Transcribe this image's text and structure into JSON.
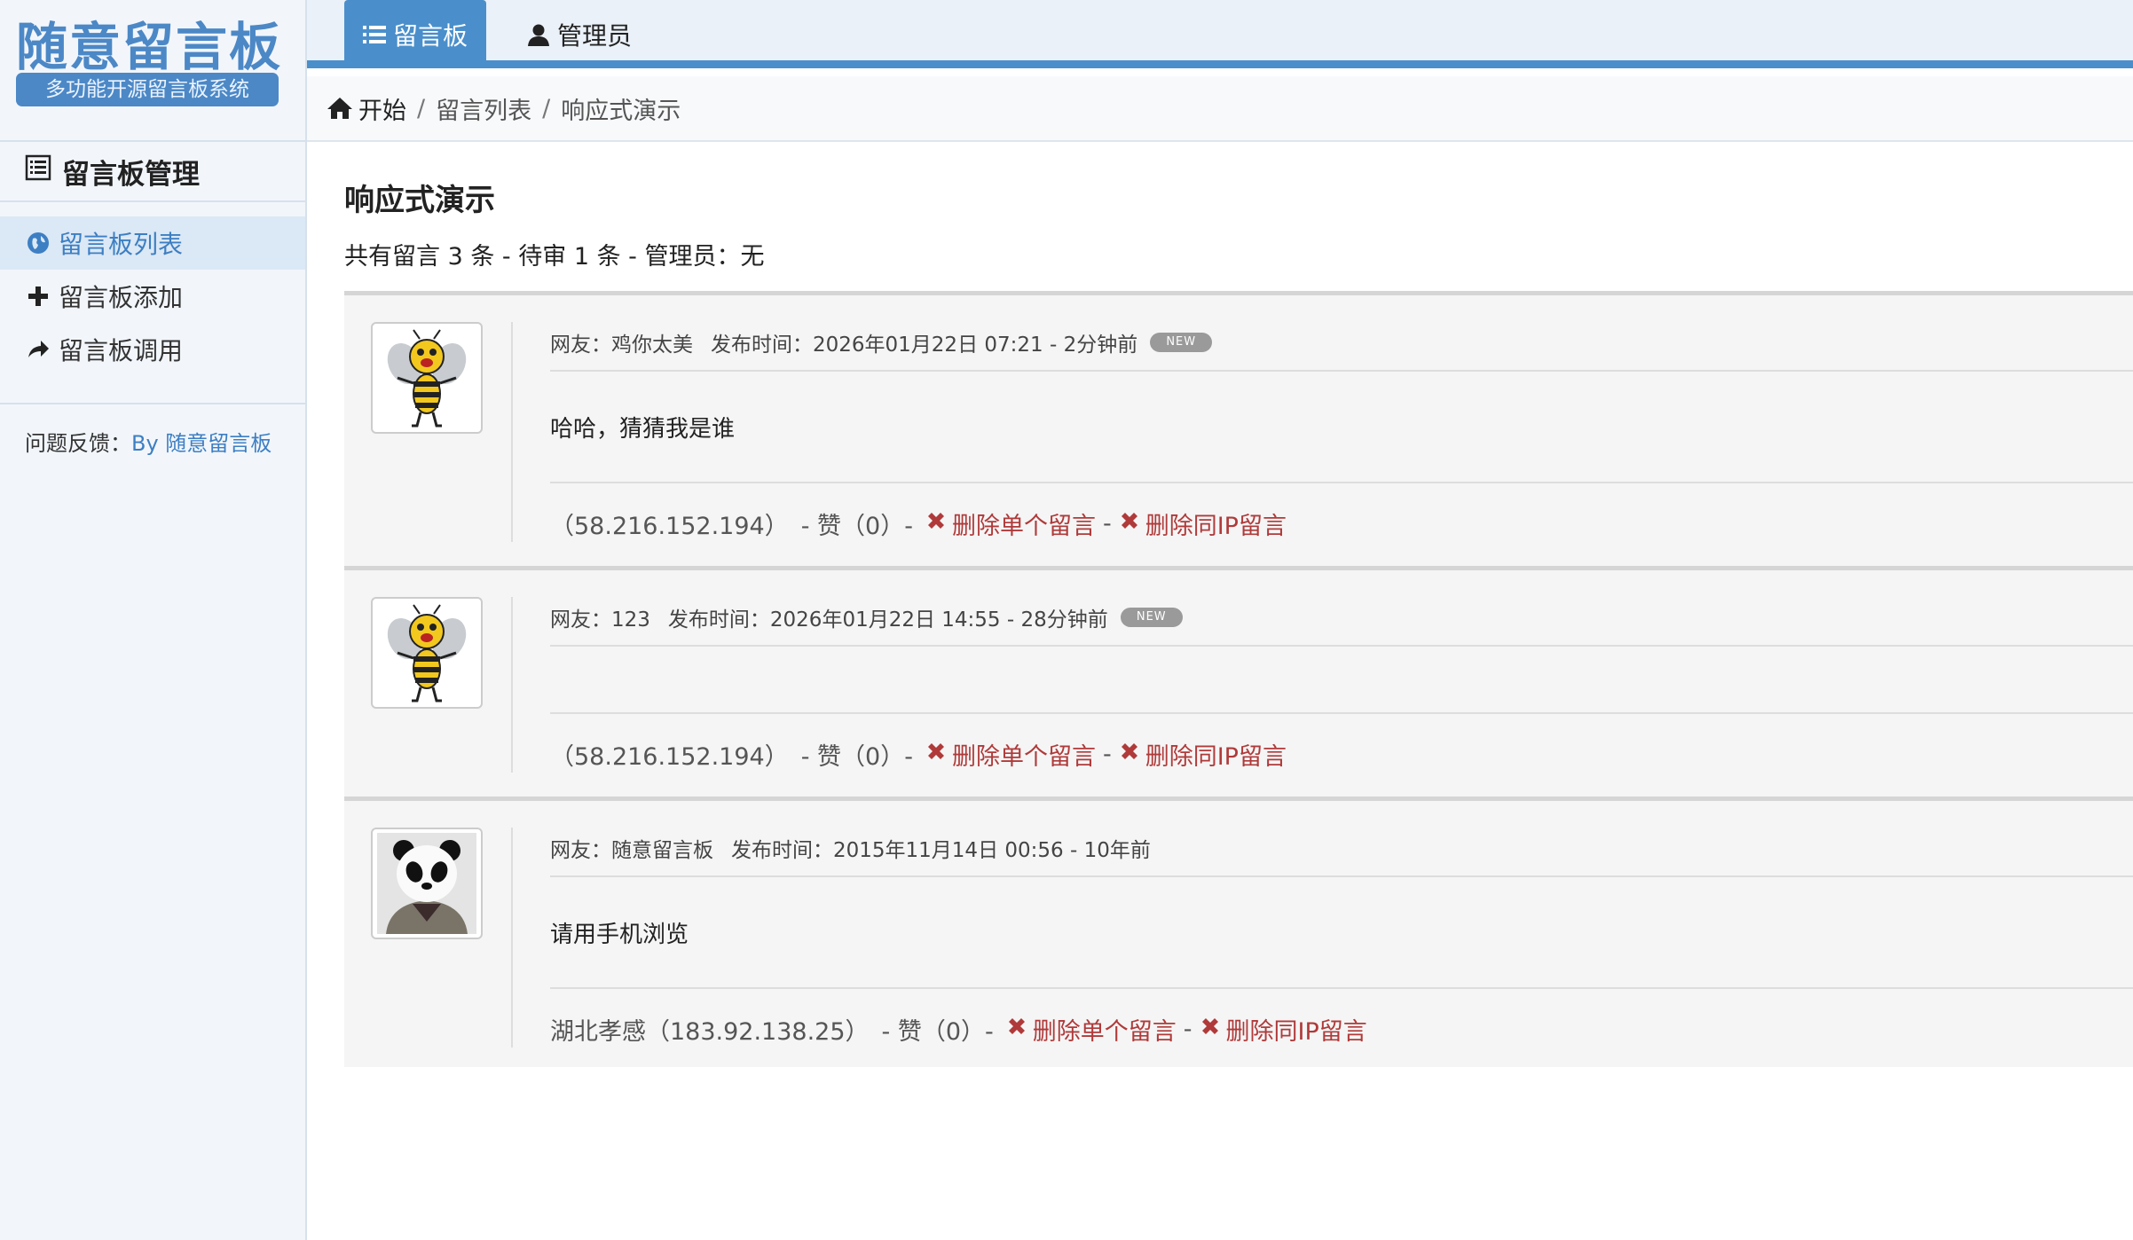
{
  "brand": {
    "title": "随意留言板",
    "subtitle": "多功能开源留言板系统"
  },
  "nav": {
    "tabs": [
      {
        "label": "留言板",
        "icon": "list-icon",
        "active": true
      },
      {
        "label": "管理员",
        "icon": "user-icon",
        "active": false
      }
    ]
  },
  "sidebar": {
    "header": "留言板管理",
    "items": [
      {
        "label": "留言板列表",
        "icon": "globe-icon",
        "active": true
      },
      {
        "label": "留言板添加",
        "icon": "plus-icon",
        "active": false
      },
      {
        "label": "留言板调用",
        "icon": "share-arrow-icon",
        "active": false
      }
    ],
    "feedback_label": "问题反馈：",
    "feedback_link": "By 随意留言板"
  },
  "breadcrumb": {
    "home": "开始",
    "sep": "/",
    "level1": "留言列表",
    "level2": "响应式演示"
  },
  "page": {
    "title": "响应式演示",
    "summary": "共有留言 3 条 - 待审 1 条 - 管理员：无"
  },
  "messages": [
    {
      "user": "网友：鸡你太美",
      "time": "发布时间：2026年01月22日 07:21 - 2分钟前",
      "badge": "NEW",
      "body": "哈哈，猜猜我是谁",
      "location_ip": "（58.216.152.194）",
      "likes": "- 赞（0）-",
      "delete_single": "删除单个留言",
      "dash": "-",
      "delete_ip": "删除同IP留言",
      "avatar": "bee"
    },
    {
      "user": "网友：123",
      "time": "发布时间：2026年01月22日 14:55 - 28分钟前",
      "badge": "NEW",
      "body": "",
      "location_ip": "（58.216.152.194）",
      "likes": "- 赞（0）-",
      "delete_single": "删除单个留言",
      "dash": "-",
      "delete_ip": "删除同IP留言",
      "avatar": "bee"
    },
    {
      "user": "网友：随意留言板",
      "time": "发布时间：2015年11月14日 00:56 - 10年前",
      "badge": "",
      "body": "请用手机浏览",
      "location_ip": "湖北孝感（183.92.138.25）",
      "likes": "- 赞（0）-",
      "delete_single": "删除单个留言",
      "dash": "-",
      "delete_ip": "删除同IP留言",
      "avatar": "panda"
    }
  ],
  "colors": {
    "accent": "#4a8fcb",
    "link": "#3d7fc3",
    "danger": "#b03a3a"
  }
}
